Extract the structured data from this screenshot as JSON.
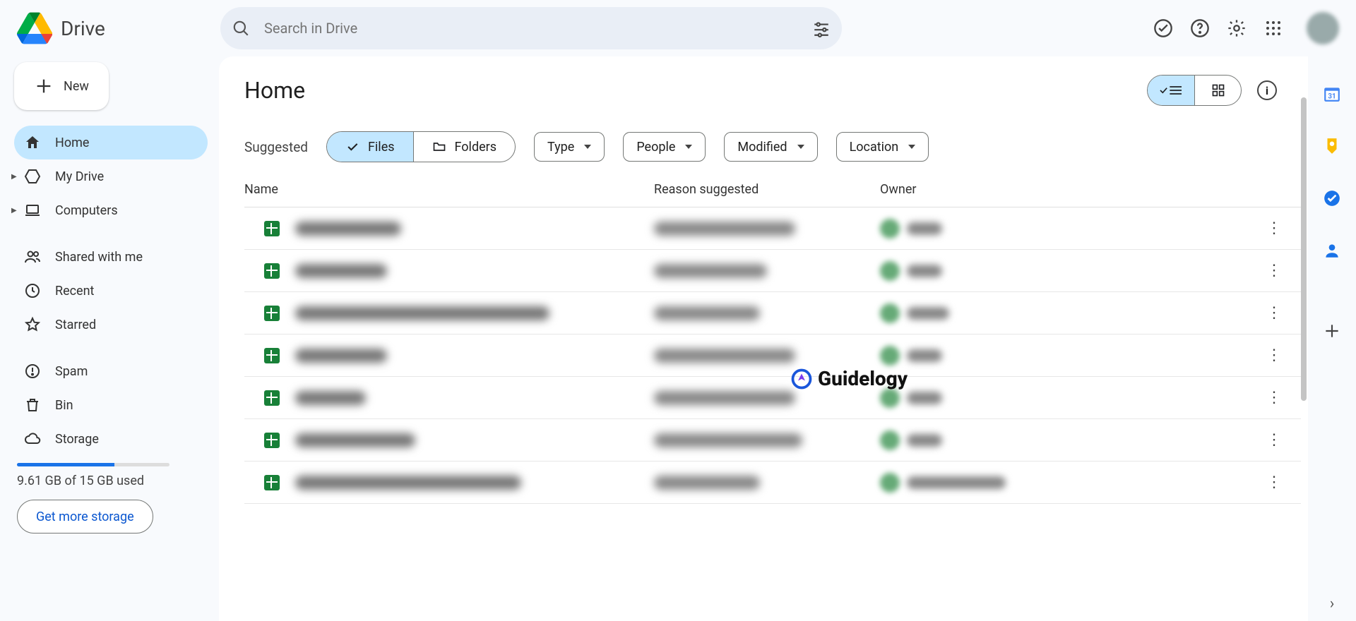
{
  "app": {
    "brand": "Drive"
  },
  "search": {
    "placeholder": "Search in Drive"
  },
  "buttons": {
    "new": "New",
    "get_more_storage": "Get more storage"
  },
  "sidebar": {
    "items": [
      {
        "label": "Home",
        "active": true
      },
      {
        "label": "My Drive",
        "expandable": true
      },
      {
        "label": "Computers",
        "expandable": true
      },
      {
        "label": "Shared with me"
      },
      {
        "label": "Recent"
      },
      {
        "label": "Starred"
      },
      {
        "label": "Spam"
      },
      {
        "label": "Bin"
      },
      {
        "label": "Storage"
      }
    ],
    "storage": {
      "used_text": "9.61 GB of 15 GB used",
      "used_percent": 64
    }
  },
  "main": {
    "title": "Home",
    "suggested_label": "Suggested",
    "segments": {
      "files": "Files",
      "folders": "Folders"
    },
    "filters": {
      "type": "Type",
      "people": "People",
      "modified": "Modified",
      "location": "Location"
    },
    "columns": {
      "name": "Name",
      "reason": "Reason suggested",
      "owner": "Owner"
    },
    "rows": [
      {
        "name_w": 150,
        "reason_w": 200,
        "owner_w": 50
      },
      {
        "name_w": 130,
        "reason_w": 160,
        "owner_w": 50
      },
      {
        "name_w": 360,
        "reason_w": 150,
        "owner_w": 60
      },
      {
        "name_w": 130,
        "reason_w": 200,
        "owner_w": 50
      },
      {
        "name_w": 100,
        "reason_w": 200,
        "owner_w": 50
      },
      {
        "name_w": 170,
        "reason_w": 210,
        "owner_w": 50
      },
      {
        "name_w": 320,
        "reason_w": 150,
        "owner_w": 140
      }
    ]
  },
  "watermark": {
    "text": "Guidelogy"
  }
}
